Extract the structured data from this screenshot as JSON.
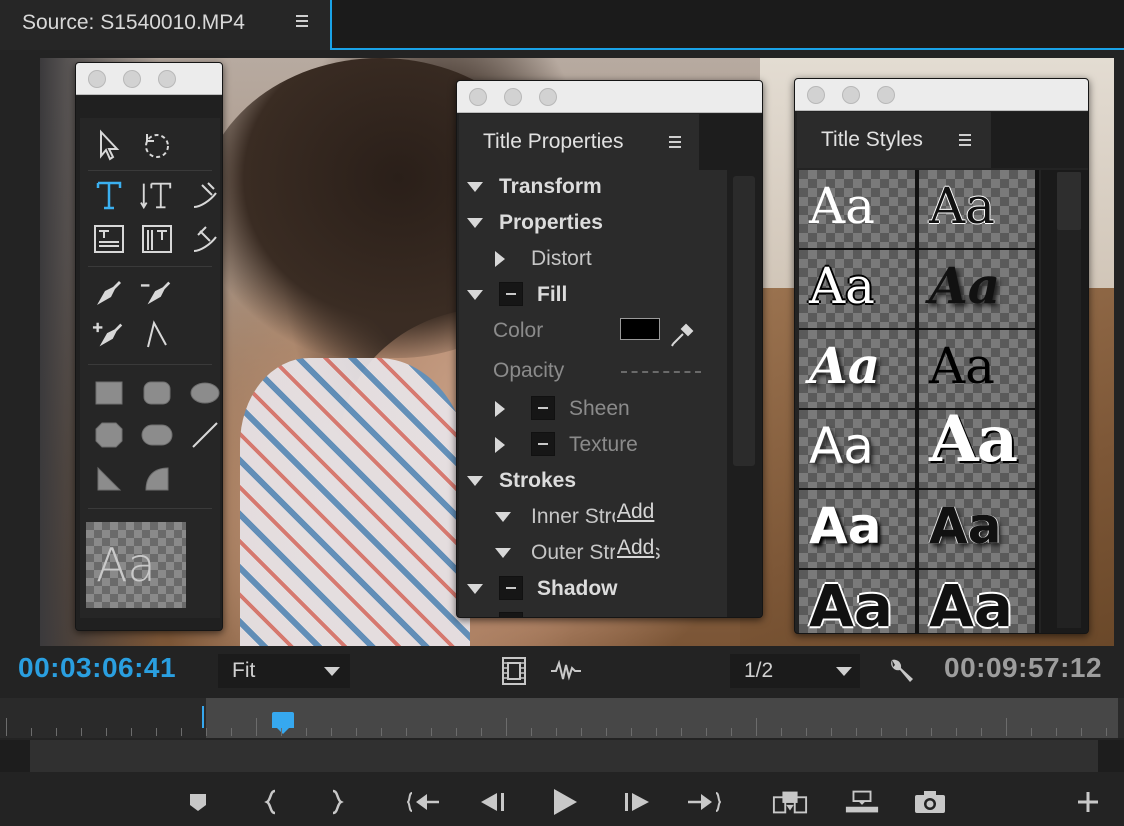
{
  "tab": {
    "title": "Source: S1540010.MP4"
  },
  "tools_panel": {
    "preview_text": "Aa"
  },
  "title_properties": {
    "title": "Title Properties",
    "rows": {
      "transform": "Transform",
      "properties": "Properties",
      "distort": "Distort",
      "fill": "Fill",
      "color": "Color",
      "opacity": "Opacity",
      "sheen": "Sheen",
      "texture": "Texture",
      "strokes": "Strokes",
      "inner_strokes": "Inner Strokes",
      "outer_strokes": "Outer Strokes",
      "add_inner": "Add",
      "add_outer": "Add",
      "shadow": "Shadow"
    },
    "fill_color": "#000000"
  },
  "title_styles": {
    "title": "Title Styles",
    "sample_text": "Aa"
  },
  "controls": {
    "current_timecode": "00:03:06:41",
    "duration_timecode": "00:09:57:12",
    "zoom_select": "Fit",
    "resolution_select": "1/2"
  },
  "colors": {
    "accent": "#1aa3e8",
    "timecode_current": "#2a9fe0",
    "timecode_duration": "#9d9d9d"
  },
  "icons": {
    "transport": [
      "add-marker-icon",
      "mark-in-icon",
      "mark-out-icon",
      "go-to-in-icon",
      "step-back-icon",
      "play-icon",
      "step-forward-icon",
      "go-to-out-icon",
      "insert-icon",
      "overwrite-icon",
      "export-frame-icon",
      "add-button-icon"
    ]
  }
}
